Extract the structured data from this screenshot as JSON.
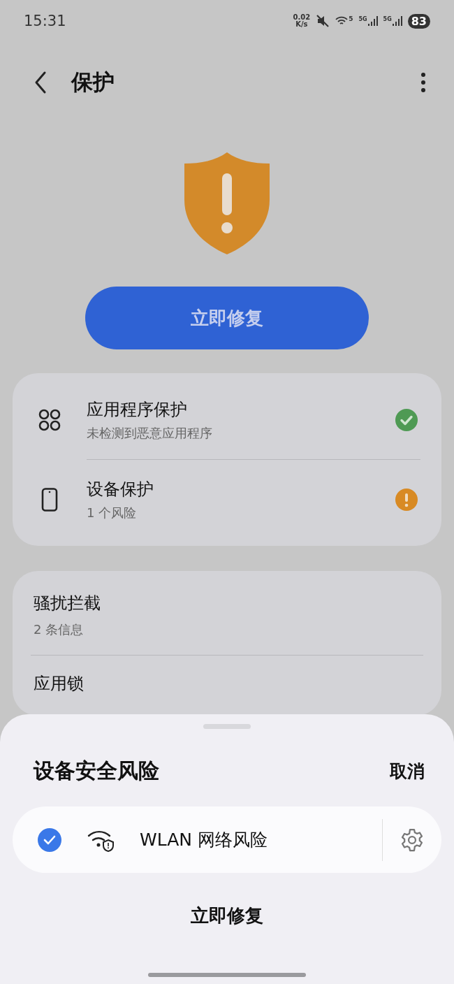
{
  "status_bar": {
    "time": "15:31",
    "speed_value": "0.02",
    "speed_unit": "K/s",
    "wifi_badge": "5",
    "sim_1": "5G",
    "sim_2": "5G",
    "battery": "83"
  },
  "header": {
    "title": "保护"
  },
  "fix_button": "立即修复",
  "protection_items": [
    {
      "title": "应用程序保护",
      "subtitle": "未检测到恶意应用程序",
      "at_risk": false,
      "kind": "apps"
    },
    {
      "title": "设备保护",
      "subtitle": "1 个风险",
      "at_risk": true,
      "kind": "phone"
    }
  ],
  "other_items": [
    {
      "title": "骚扰拦截",
      "subtitle": "2 条信息"
    },
    {
      "title": "应用锁"
    }
  ],
  "sheet": {
    "title": "设备安全风险",
    "cancel": "取消",
    "risks": [
      {
        "label": "WLAN 网络风险",
        "checked": true
      }
    ],
    "fix_button": "立即修复"
  }
}
